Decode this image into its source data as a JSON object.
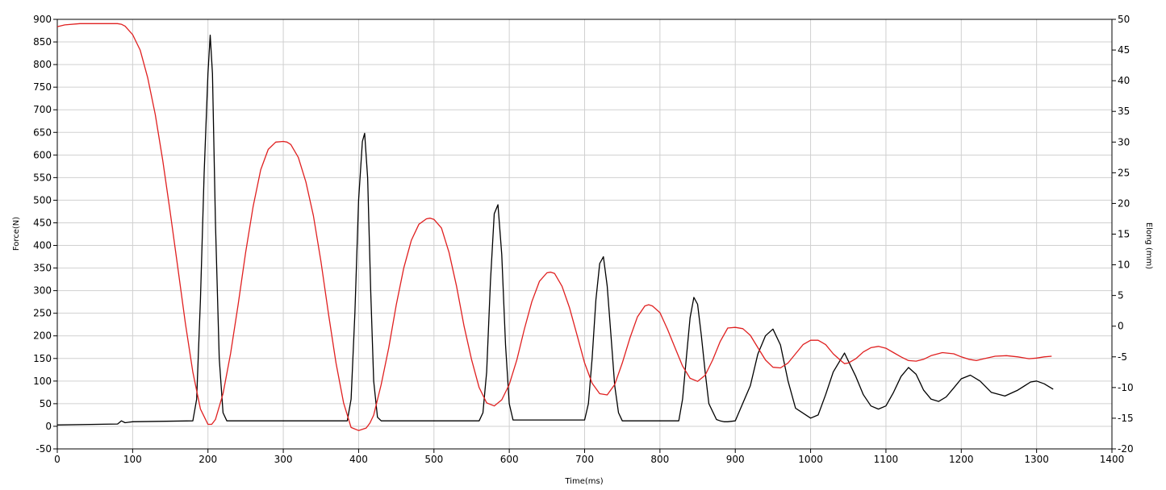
{
  "chart_data": {
    "type": "line",
    "xlabel": "Time(ms)",
    "ylabel": "Force(N)",
    "y2label": "Elong (mm)",
    "xlim": [
      0,
      1400
    ],
    "ylim": [
      -50,
      900
    ],
    "y2lim": [
      -20,
      50
    ],
    "x_ticks": [
      0,
      100,
      200,
      300,
      400,
      500,
      600,
      700,
      800,
      900,
      1000,
      1100,
      1200,
      1300,
      1400
    ],
    "y_ticks": [
      -50,
      0,
      50,
      100,
      150,
      200,
      250,
      300,
      350,
      400,
      450,
      500,
      550,
      600,
      650,
      700,
      750,
      800,
      850,
      900
    ],
    "y2_ticks": [
      -20,
      -15,
      -10,
      -5,
      0,
      5,
      10,
      15,
      20,
      25,
      30,
      35,
      40,
      45,
      50
    ],
    "grid": true,
    "series": [
      {
        "axis": "left",
        "color": "#000000",
        "x": [
          0,
          80,
          85,
          90,
          95,
          100,
          180,
          185,
          190,
          195,
          200,
          203,
          206,
          210,
          215,
          220,
          225,
          385,
          390,
          395,
          400,
          405,
          408,
          412,
          416,
          420,
          425,
          430,
          560,
          565,
          570,
          575,
          580,
          585,
          590,
          595,
          600,
          605,
          700,
          705,
          710,
          715,
          720,
          725,
          730,
          735,
          740,
          745,
          750,
          825,
          830,
          835,
          840,
          845,
          850,
          855,
          860,
          865,
          875,
          880,
          885,
          890,
          900,
          920,
          930,
          940,
          950,
          960,
          970,
          980,
          1000,
          1010,
          1020,
          1030,
          1045,
          1060,
          1070,
          1080,
          1090,
          1100,
          1110,
          1120,
          1130,
          1140,
          1150,
          1160,
          1170,
          1180,
          1190,
          1200,
          1212,
          1225,
          1240,
          1258,
          1275,
          1292,
          1300,
          1310,
          1322
        ],
        "y": [
          3,
          5,
          12,
          8,
          9,
          10,
          12,
          60,
          280,
          560,
          780,
          865,
          780,
          450,
          150,
          30,
          12,
          12,
          60,
          250,
          500,
          630,
          648,
          550,
          300,
          100,
          20,
          12,
          12,
          30,
          120,
          320,
          470,
          490,
          380,
          180,
          50,
          14,
          14,
          50,
          150,
          280,
          360,
          375,
          310,
          200,
          90,
          30,
          12,
          12,
          60,
          150,
          240,
          285,
          270,
          200,
          120,
          50,
          15,
          12,
          10,
          10,
          12,
          90,
          160,
          200,
          215,
          180,
          100,
          40,
          18,
          25,
          70,
          120,
          162,
          110,
          70,
          45,
          38,
          45,
          75,
          110,
          130,
          115,
          80,
          60,
          55,
          65,
          85,
          105,
          113,
          100,
          75,
          67,
          80,
          98,
          100,
          94,
          82
        ]
      },
      {
        "axis": "right",
        "color": "#e02020",
        "x": [
          0,
          10,
          30,
          50,
          70,
          80,
          85,
          90,
          100,
          110,
          120,
          130,
          140,
          150,
          160,
          170,
          180,
          190,
          200,
          205,
          210,
          220,
          230,
          240,
          250,
          260,
          270,
          280,
          290,
          300,
          305,
          310,
          320,
          330,
          340,
          350,
          360,
          370,
          380,
          390,
          400,
          410,
          415,
          420,
          430,
          440,
          450,
          460,
          470,
          480,
          490,
          495,
          500,
          510,
          520,
          530,
          540,
          550,
          560,
          570,
          580,
          590,
          600,
          610,
          620,
          630,
          640,
          650,
          655,
          660,
          670,
          680,
          690,
          700,
          710,
          720,
          730,
          740,
          750,
          760,
          770,
          780,
          785,
          790,
          800,
          810,
          820,
          830,
          840,
          850,
          860,
          870,
          880,
          890,
          900,
          910,
          920,
          930,
          940,
          950,
          960,
          970,
          980,
          990,
          1000,
          1010,
          1020,
          1030,
          1040,
          1045,
          1050,
          1060,
          1070,
          1080,
          1090,
          1100,
          1110,
          1120,
          1130,
          1140,
          1150,
          1160,
          1175,
          1190,
          1200,
          1210,
          1220,
          1230,
          1245,
          1260,
          1275,
          1290,
          1300,
          1310,
          1320
        ],
        "y": [
          48.8,
          49.1,
          49.3,
          49.3,
          49.3,
          49.3,
          49.2,
          48.9,
          47.5,
          45.0,
          40.5,
          34.5,
          27.0,
          18.5,
          9.5,
          0.5,
          -7.5,
          -13.5,
          -16.0,
          -16.0,
          -15.2,
          -11.0,
          -4.5,
          3.5,
          12.0,
          19.5,
          25.5,
          28.8,
          30.0,
          30.1,
          30.0,
          29.6,
          27.5,
          23.5,
          18.0,
          10.5,
          2.0,
          -6.0,
          -12.5,
          -16.5,
          -17.0,
          -16.6,
          -15.8,
          -14.5,
          -9.5,
          -3.5,
          3.5,
          9.5,
          14.0,
          16.6,
          17.5,
          17.6,
          17.4,
          16.0,
          12.0,
          6.5,
          0.0,
          -5.5,
          -10.0,
          -12.5,
          -13.0,
          -12.0,
          -9.5,
          -5.5,
          -0.5,
          4.0,
          7.3,
          8.7,
          8.8,
          8.6,
          6.5,
          3.0,
          -1.5,
          -6.0,
          -9.3,
          -11.0,
          -11.2,
          -9.5,
          -6.0,
          -2.0,
          1.5,
          3.3,
          3.5,
          3.3,
          2.2,
          -0.5,
          -3.5,
          -6.5,
          -8.5,
          -9.0,
          -8.0,
          -5.5,
          -2.5,
          -0.3,
          -0.2,
          -0.4,
          -1.5,
          -3.5,
          -5.5,
          -6.7,
          -6.8,
          -6.0,
          -4.5,
          -3.0,
          -2.3,
          -2.3,
          -3.0,
          -4.5,
          -5.6,
          -6.1,
          -6.0,
          -5.3,
          -4.2,
          -3.5,
          -3.3,
          -3.6,
          -4.3,
          -5.0,
          -5.6,
          -5.7,
          -5.4,
          -4.8,
          -4.3,
          -4.5,
          -5.0,
          -5.4,
          -5.6,
          -5.3,
          -4.9,
          -4.8,
          -5.0,
          -5.3,
          -5.2,
          -5.0,
          -4.9
        ]
      }
    ]
  }
}
